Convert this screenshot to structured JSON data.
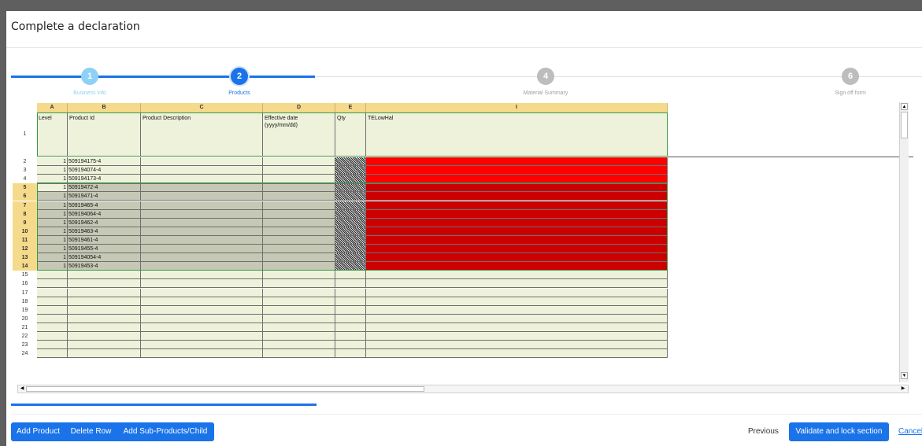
{
  "dialog": {
    "title": "Complete a declaration"
  },
  "steps": [
    {
      "number": "1",
      "label": "Business info",
      "state": "completed"
    },
    {
      "number": "2",
      "label": "Products",
      "state": "active"
    },
    {
      "number": "4",
      "label": "Material Summary",
      "state": "pending"
    },
    {
      "number": "6",
      "label": "Sign off form",
      "state": "pending"
    }
  ],
  "sheet": {
    "columns": [
      {
        "letter": "A",
        "header": "Level"
      },
      {
        "letter": "B",
        "header": "Product Id"
      },
      {
        "letter": "C",
        "header": "Product Description"
      },
      {
        "letter": "D",
        "header": "Effective date\n(yyyy/mm/dd)"
      },
      {
        "letter": "E",
        "header": "Qty"
      },
      {
        "letter": "I",
        "header": "TELowHal"
      }
    ],
    "rows": [
      {
        "num": "2",
        "level": "1",
        "product_id": "509194175-4"
      },
      {
        "num": "3",
        "level": "1",
        "product_id": "509194074-4"
      },
      {
        "num": "4",
        "level": "1",
        "product_id": "509194173-4"
      },
      {
        "num": "5",
        "level": "1",
        "product_id": "50919472-4"
      },
      {
        "num": "6",
        "level": "1",
        "product_id": "50919471-4"
      },
      {
        "num": "7",
        "level": "1",
        "product_id": "50919465-4"
      },
      {
        "num": "8",
        "level": "1",
        "product_id": "509194064-4"
      },
      {
        "num": "9",
        "level": "1",
        "product_id": "50919462-4"
      },
      {
        "num": "10",
        "level": "1",
        "product_id": "50919463-4"
      },
      {
        "num": "11",
        "level": "1",
        "product_id": "50919461-4"
      },
      {
        "num": "12",
        "level": "1",
        "product_id": "50919455-4"
      },
      {
        "num": "13",
        "level": "1",
        "product_id": "509194054-4"
      },
      {
        "num": "14",
        "level": "1",
        "product_id": "50919453-4"
      }
    ],
    "empty_rows": [
      "15",
      "16",
      "17",
      "18",
      "19",
      "20",
      "21",
      "22",
      "23",
      "24"
    ]
  },
  "footer": {
    "add_product": "Add Product",
    "delete_row": "Delete Row",
    "add_sub_products": "Add Sub-Products/Child",
    "previous": "Previous",
    "validate": "Validate and lock section",
    "cancel": "Cancel"
  },
  "colors": {
    "accent": "#1a73e8",
    "step_complete": "#8fd0f5",
    "step_pending": "#bdbdbd",
    "cell_bg": "#eef2da",
    "selected_bg": "#c5c8b4",
    "red": "#ff0000",
    "dark_red": "#cc0000",
    "header_yellow": "#f4da8a"
  }
}
